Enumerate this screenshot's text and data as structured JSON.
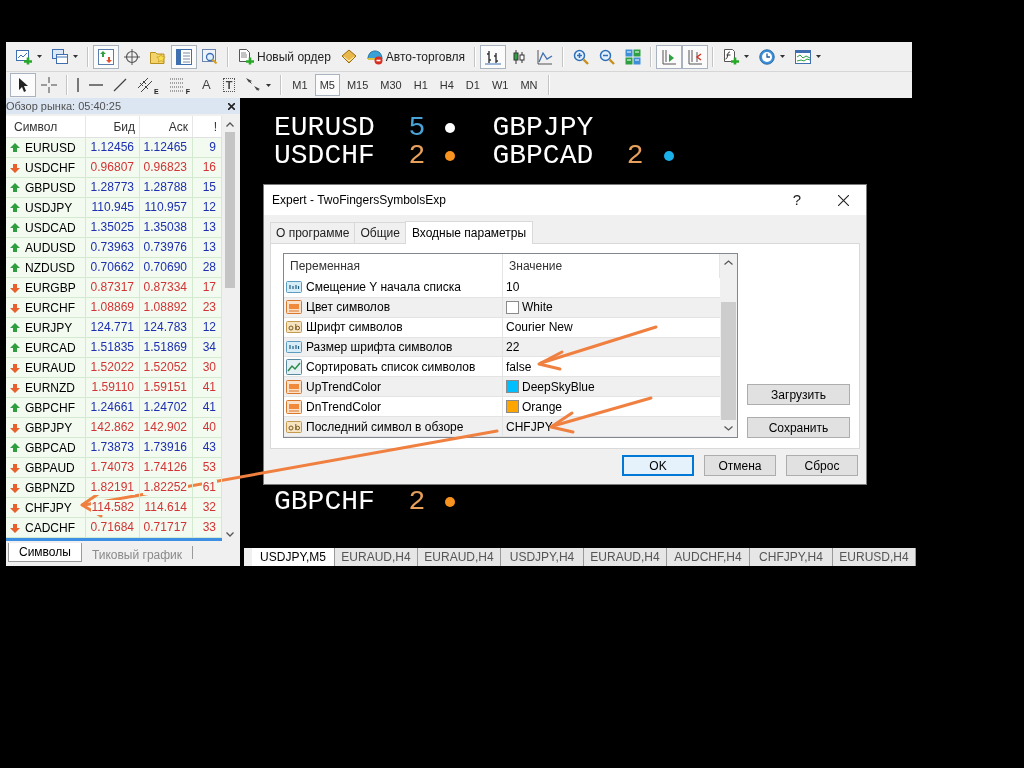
{
  "toolbar": {
    "groups": [
      [
        {
          "kind": "new-chart",
          "dropdown": true
        },
        {
          "kind": "profiles",
          "dropdown": true
        }
      ],
      [
        {
          "kind": "market-watch",
          "selected": true
        },
        {
          "kind": "data-window",
          "selected": false
        },
        {
          "kind": "navigator",
          "selected": false
        },
        {
          "kind": "terminal",
          "selected": true
        },
        {
          "kind": "tester",
          "selected": false
        }
      ],
      [
        {
          "kind": "new-order",
          "label": "Новый ордер"
        },
        {
          "kind": "editor"
        },
        {
          "kind": "auto-trading",
          "label": "Авто-торговля"
        }
      ],
      [
        {
          "kind": "bars",
          "selected": true
        },
        {
          "kind": "candles",
          "selected": false
        },
        {
          "kind": "line",
          "selected": false
        }
      ],
      [
        {
          "kind": "zoom-in"
        },
        {
          "kind": "zoom-out"
        },
        {
          "kind": "tile"
        }
      ],
      [
        {
          "kind": "auto-scroll",
          "selected": true
        },
        {
          "kind": "chart-shift",
          "selected": true
        }
      ],
      [
        {
          "kind": "indicators",
          "dropdown": true
        },
        {
          "kind": "periods",
          "dropdown": true
        },
        {
          "kind": "templates",
          "dropdown": true
        }
      ]
    ]
  },
  "drawing_toolbar": {
    "groups": [
      [
        {
          "kind": "cursor",
          "selected": true
        },
        {
          "kind": "crosshair",
          "selected": false
        }
      ],
      [
        {
          "kind": "vertical-line",
          "selected": false
        },
        {
          "kind": "horizontal-line",
          "selected": false
        },
        {
          "kind": "trend-line",
          "selected": false
        },
        {
          "kind": "channel",
          "glyph": "E",
          "selected": false
        },
        {
          "kind": "fibonacci",
          "glyph": "F",
          "selected": false
        },
        {
          "kind": "text",
          "glyph": "A",
          "selected": false
        },
        {
          "kind": "text-label",
          "glyph": "T",
          "selected": false
        },
        {
          "kind": "arrows",
          "dropdown": true
        }
      ]
    ],
    "timeframes": [
      {
        "label": "M1",
        "selected": false
      },
      {
        "label": "M5",
        "selected": true
      },
      {
        "label": "M15",
        "selected": false
      },
      {
        "label": "M30",
        "selected": false
      },
      {
        "label": "H1",
        "selected": false
      },
      {
        "label": "H4",
        "selected": false
      },
      {
        "label": "D1",
        "selected": false
      },
      {
        "label": "W1",
        "selected": false
      },
      {
        "label": "MN",
        "selected": false
      }
    ]
  },
  "market_watch": {
    "title": "Обзор рынка: 05:40:25",
    "columns": [
      "Символ",
      "Бид",
      "Аск",
      "!"
    ],
    "rows": [
      {
        "cells": [
          "EURUSD",
          "1.12456",
          "1.12465",
          "9"
        ],
        "rising": true
      },
      {
        "cells": [
          "USDCHF",
          "0.96807",
          "0.96823",
          "16"
        ],
        "rising": false
      },
      {
        "cells": [
          "GBPUSD",
          "1.28773",
          "1.28788",
          "15"
        ],
        "rising": true
      },
      {
        "cells": [
          "USDJPY",
          "110.945",
          "110.957",
          "12"
        ],
        "rising": true
      },
      {
        "cells": [
          "USDCAD",
          "1.35025",
          "1.35038",
          "13"
        ],
        "rising": true
      },
      {
        "cells": [
          "AUDUSD",
          "0.73963",
          "0.73976",
          "13"
        ],
        "rising": true
      },
      {
        "cells": [
          "NZDUSD",
          "0.70662",
          "0.70690",
          "28"
        ],
        "rising": true
      },
      {
        "cells": [
          "EURGBP",
          "0.87317",
          "0.87334",
          "17"
        ],
        "rising": false
      },
      {
        "cells": [
          "EURCHF",
          "1.08869",
          "1.08892",
          "23"
        ],
        "rising": false
      },
      {
        "cells": [
          "EURJPY",
          "124.771",
          "124.783",
          "12"
        ],
        "rising": true
      },
      {
        "cells": [
          "EURCAD",
          "1.51835",
          "1.51869",
          "34"
        ],
        "rising": true
      },
      {
        "cells": [
          "EURAUD",
          "1.52022",
          "1.52052",
          "30"
        ],
        "rising": false
      },
      {
        "cells": [
          "EURNZD",
          "1.59110",
          "1.59151",
          "41"
        ],
        "rising": false
      },
      {
        "cells": [
          "GBPCHF",
          "1.24661",
          "1.24702",
          "41"
        ],
        "rising": true
      },
      {
        "cells": [
          "GBPJPY",
          "142.862",
          "142.902",
          "40"
        ],
        "rising": false
      },
      {
        "cells": [
          "GBPCAD",
          "1.73873",
          "1.73916",
          "43"
        ],
        "rising": true
      },
      {
        "cells": [
          "GBPAUD",
          "1.74073",
          "1.74126",
          "53"
        ],
        "rising": false
      },
      {
        "cells": [
          "GBPNZD",
          "1.82191",
          "1.82252",
          "61"
        ],
        "rising": false
      },
      {
        "cells": [
          "CHFJPY",
          "114.582",
          "114.614",
          "32"
        ],
        "rising": false
      },
      {
        "cells": [
          "CADCHF",
          "0.71684",
          "0.71717",
          "33"
        ],
        "rising": false
      }
    ],
    "tabs": [
      {
        "label": "Символы",
        "selected": true
      },
      {
        "label": "Тиковый график",
        "selected": false
      }
    ]
  },
  "chart": {
    "rows": [
      [
        {
          "symbol": "EURUSD",
          "count": {
            "label": "5",
            "color": "#4aa3d8"
          },
          "dot": {
            "color": "#ffffff"
          }
        },
        {
          "symbol": "GBPJPY"
        }
      ],
      [
        {
          "symbol": "USDCHF",
          "count": {
            "label": "2",
            "color": "#e8a15c"
          },
          "dot": {
            "color": "#f7931e"
          }
        },
        {
          "symbol": "GBPCAD",
          "count": {
            "label": "2",
            "color": "#e8a15c"
          },
          "dot": {
            "color": "#1ab0ea"
          }
        }
      ]
    ],
    "lower_rows": [
      [
        {
          "symbol": "GBPCHF",
          "count": {
            "label": "2",
            "color": "#e8a15c"
          },
          "dot": {
            "color": "#f7931e"
          }
        }
      ]
    ]
  },
  "chart_tabs": [
    {
      "label": "USDJPY,M5",
      "selected": true
    },
    {
      "label": "EURAUD,H4",
      "selected": false
    },
    {
      "label": "EURAUD,H4",
      "selected": false
    },
    {
      "label": "USDJPY,H4",
      "selected": false
    },
    {
      "label": "EURAUD,H4",
      "selected": false
    },
    {
      "label": "AUDCHF,H4",
      "selected": false
    },
    {
      "label": "CHFJPY,H4",
      "selected": false
    },
    {
      "label": "EURUSD,H4",
      "selected": false
    }
  ],
  "dialog": {
    "title": "Expert - TwoFingersSymbolsExp",
    "help_label": "?",
    "tabs": [
      {
        "label": "О программе",
        "selected": false
      },
      {
        "label": "Общие",
        "selected": false
      },
      {
        "label": "Входные параметры",
        "selected": true
      }
    ],
    "table": {
      "columns": [
        "Переменная",
        "Значение"
      ],
      "rows": [
        {
          "kind": "int",
          "name": "Смещение Y начала списка",
          "value": "10"
        },
        {
          "kind": "color",
          "name": "Цвет символов",
          "value": "White",
          "color": "#ffffff"
        },
        {
          "kind": "string",
          "name": "Шрифт символов",
          "value": "Courier New"
        },
        {
          "kind": "int",
          "name": "Размер шрифта символов",
          "value": "22"
        },
        {
          "kind": "bool",
          "name": "Сортировать список символов",
          "value": "false"
        },
        {
          "kind": "color",
          "name": "UpTrendColor",
          "value": "DeepSkyBlue",
          "color": "#00bfff"
        },
        {
          "kind": "color",
          "name": "DnTrendColor",
          "value": "Orange",
          "color": "#ffa500"
        },
        {
          "kind": "string",
          "name": "Последний символ в обзоре",
          "value": "CHFJPY"
        }
      ]
    },
    "side_buttons": [
      "Загрузить",
      "Сохранить"
    ],
    "buttons": [
      {
        "label": "OK",
        "focused": true
      },
      {
        "label": "Отмена",
        "focused": false
      },
      {
        "label": "Сброс",
        "focused": false
      }
    ]
  }
}
